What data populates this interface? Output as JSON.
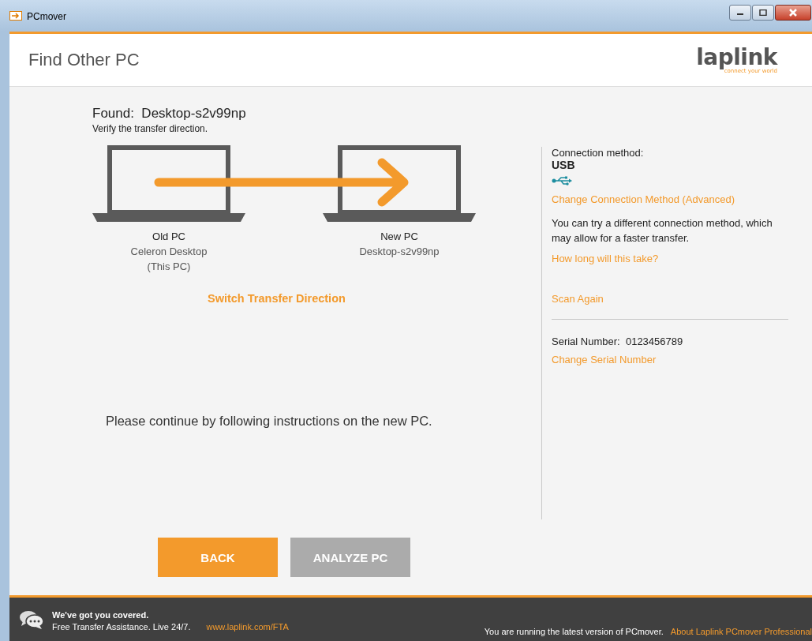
{
  "window": {
    "title": "PCmover"
  },
  "header": {
    "title": "Find Other PC",
    "logo": "laplink",
    "logo_tagline": "connect your world"
  },
  "found": {
    "title": "Found:  Desktop-s2v99np",
    "subtitle": "Verify the transfer direction."
  },
  "computers": [
    {
      "role": "Old PC",
      "name": "Celeron Desktop",
      "note": "(This PC)"
    },
    {
      "role": "New PC",
      "name": "Desktop-s2v99np"
    }
  ],
  "switch_link": "Switch Transfer Direction",
  "instruction": "Please continue by following instructions on the new PC.",
  "buttons": [
    {
      "label": "BACK",
      "disabled": false
    },
    {
      "label": "ANALYZE PC",
      "disabled": true
    }
  ],
  "side": {
    "connection_label": "Connection method:",
    "connection_value": "USB",
    "change_connection": "Change Connection Method (Advanced)",
    "hint": "You can try a different connection method, which may allow for a faster transfer.",
    "how_long": "How long will this take?",
    "scan_again": "Scan Again",
    "serial_label": "Serial Number:  0123456789",
    "change_serial": "Change Serial Number"
  },
  "footer": {
    "headline": "We've got you covered.",
    "assist": "Free Transfer Assistance. Live 24/7.",
    "link": "www.laplink.com/FTA",
    "status": "You are running the latest version of PCmover.",
    "about": "About Laplink PCmover Professional"
  }
}
